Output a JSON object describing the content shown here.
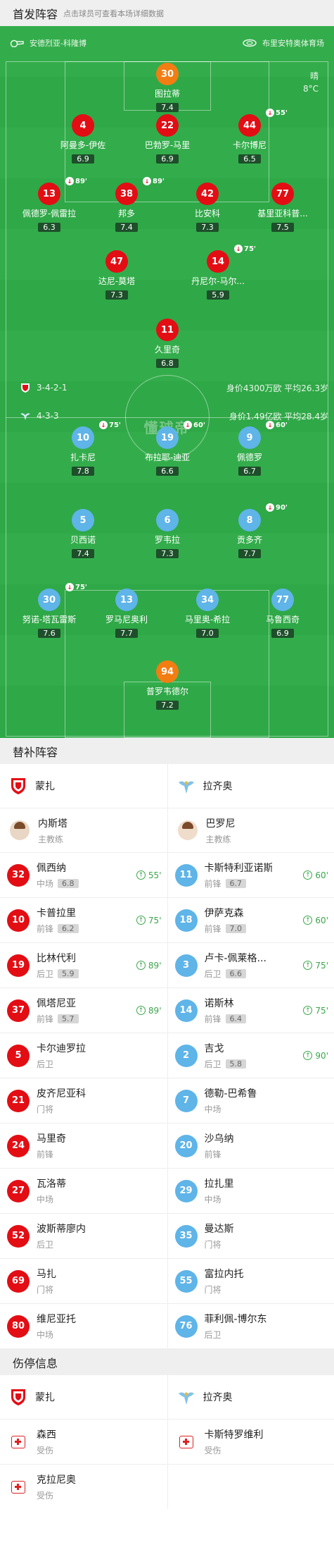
{
  "lineup_header": {
    "title": "首发阵容",
    "hint": "点击球员可查看本场详细数据"
  },
  "pitch_info": {
    "referee": "安德烈亚-科隆博",
    "stadium": "布里安特奥体育场",
    "weather": "晴",
    "temperature": "8°C",
    "watermark": "懂球帝"
  },
  "home_team_bar": {
    "formation": "3-4-2-1",
    "value": "身价4300万欧 平均26.3岁"
  },
  "away_team_bar": {
    "formation": "4-3-3",
    "value": "身价1.49亿欧 平均28.4岁"
  },
  "home_players": [
    {
      "num": "30",
      "name": "图拉蒂",
      "rating": "7.4"
    },
    {
      "num": "4",
      "name": "阿曼多-伊佐",
      "rating": "6.9"
    },
    {
      "num": "22",
      "name": "巴勃罗-马里",
      "rating": "6.9"
    },
    {
      "num": "44",
      "name": "卡尔博尼",
      "rating": "6.5",
      "sub": "55'"
    },
    {
      "num": "13",
      "name": "佩德罗-佩雷拉",
      "rating": "6.3",
      "sub": "89'"
    },
    {
      "num": "38",
      "name": "邦多",
      "rating": "7.4",
      "sub": "89'"
    },
    {
      "num": "42",
      "name": "比安科",
      "rating": "7.3"
    },
    {
      "num": "77",
      "name": "基里亚科普...",
      "rating": "7.5"
    },
    {
      "num": "47",
      "name": "达尼-莫塔",
      "rating": "7.3"
    },
    {
      "num": "14",
      "name": "丹尼尔-马尔...",
      "rating": "5.9",
      "sub": "75'"
    },
    {
      "num": "11",
      "name": "久里奇",
      "rating": "6.8"
    }
  ],
  "away_players": [
    {
      "num": "10",
      "name": "扎卡尼",
      "rating": "7.8",
      "sub": "75'"
    },
    {
      "num": "19",
      "name": "布拉耶-迪亚",
      "rating": "6.6",
      "sub": "60'"
    },
    {
      "num": "9",
      "name": "佩德罗",
      "rating": "6.7",
      "sub": "60'"
    },
    {
      "num": "5",
      "name": "贝西诺",
      "rating": "7.4"
    },
    {
      "num": "6",
      "name": "罗韦拉",
      "rating": "7.3"
    },
    {
      "num": "8",
      "name": "贡多齐",
      "rating": "7.7",
      "sub": "90'"
    },
    {
      "num": "30",
      "name": "努诺-塔瓦雷斯",
      "rating": "7.6",
      "sub": "75'"
    },
    {
      "num": "13",
      "name": "罗马尼奥利",
      "rating": "7.7"
    },
    {
      "num": "34",
      "name": "马里奥-希拉",
      "rating": "7.0"
    },
    {
      "num": "77",
      "name": "马鲁西奇",
      "rating": "6.9"
    },
    {
      "num": "94",
      "name": "普罗韦德尔",
      "rating": "7.2"
    }
  ],
  "subs_header": {
    "title": "替补阵容"
  },
  "teams": {
    "home": "蒙扎",
    "away": "拉齐奥"
  },
  "coaches": {
    "home": {
      "name": "内斯塔",
      "role": "主教练"
    },
    "away": {
      "name": "巴罗尼",
      "role": "主教练"
    }
  },
  "subs": [
    {
      "h": {
        "num": "32",
        "name": "佩西纳",
        "pos": "中场",
        "rating": "6.8",
        "evt": "55'"
      },
      "a": {
        "num": "11",
        "name": "卡斯特利亚诺斯",
        "pos": "前锋",
        "rating": "6.7",
        "evt": "60'"
      }
    },
    {
      "h": {
        "num": "10",
        "name": "卡普拉里",
        "pos": "前锋",
        "rating": "6.2",
        "evt": "75'"
      },
      "a": {
        "num": "18",
        "name": "伊萨克森",
        "pos": "前锋",
        "rating": "7.0",
        "evt": "60'"
      }
    },
    {
      "h": {
        "num": "19",
        "name": "比林代利",
        "pos": "后卫",
        "rating": "5.9",
        "evt": "89'"
      },
      "a": {
        "num": "3",
        "name": "卢卡-佩莱格...",
        "pos": "后卫",
        "rating": "6.6",
        "evt": "75'"
      }
    },
    {
      "h": {
        "num": "37",
        "name": "佩塔尼亚",
        "pos": "前锋",
        "rating": "5.7",
        "evt": "89'"
      },
      "a": {
        "num": "14",
        "name": "诺斯林",
        "pos": "前锋",
        "rating": "6.4",
        "evt": "75'"
      }
    },
    {
      "h": {
        "num": "5",
        "name": "卡尔迪罗拉",
        "pos": "后卫",
        "rating": "",
        "evt": ""
      },
      "a": {
        "num": "2",
        "name": "吉戈",
        "pos": "后卫",
        "rating": "5.8",
        "evt": "90'"
      }
    },
    {
      "h": {
        "num": "21",
        "name": "皮齐尼亚科",
        "pos": "门将",
        "rating": "",
        "evt": ""
      },
      "a": {
        "num": "7",
        "name": "德勒-巴希鲁",
        "pos": "中场",
        "rating": "",
        "evt": ""
      }
    },
    {
      "h": {
        "num": "24",
        "name": "马里奇",
        "pos": "前锋",
        "rating": "",
        "evt": ""
      },
      "a": {
        "num": "20",
        "name": "沙乌纳",
        "pos": "前锋",
        "rating": "",
        "evt": ""
      }
    },
    {
      "h": {
        "num": "27",
        "name": "瓦洛蒂",
        "pos": "中场",
        "rating": "",
        "evt": ""
      },
      "a": {
        "num": "29",
        "name": "拉扎里",
        "pos": "中场",
        "rating": "",
        "evt": ""
      }
    },
    {
      "h": {
        "num": "52",
        "name": "波斯蒂廖内",
        "pos": "后卫",
        "rating": "",
        "evt": ""
      },
      "a": {
        "num": "35",
        "name": "曼达斯",
        "pos": "门将",
        "rating": "",
        "evt": ""
      }
    },
    {
      "h": {
        "num": "69",
        "name": "马扎",
        "pos": "门将",
        "rating": "",
        "evt": ""
      },
      "a": {
        "num": "55",
        "name": "富拉内托",
        "pos": "门将",
        "rating": "",
        "evt": ""
      }
    },
    {
      "h": {
        "num": "80",
        "name": "维尼亚托",
        "pos": "中场",
        "rating": "",
        "evt": ""
      },
      "a": {
        "num": "76",
        "name": "菲利佩-博尔东",
        "pos": "后卫",
        "rating": "",
        "evt": ""
      }
    }
  ],
  "injury_header": {
    "title": "伤停信息"
  },
  "injuries": {
    "home": [
      {
        "name": "森西",
        "status": "受伤"
      },
      {
        "name": "克拉尼奥",
        "status": "受伤"
      }
    ],
    "away": [
      {
        "name": "卡斯特罗维利",
        "status": "受伤"
      }
    ]
  },
  "colors": {
    "pitch": "#2fa847",
    "home": "#e30d14",
    "away": "#5fb4e8",
    "keeper": "#f27d12"
  }
}
